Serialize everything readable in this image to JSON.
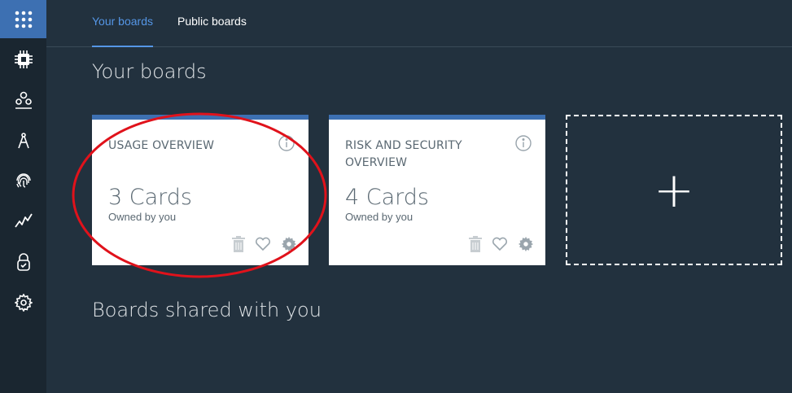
{
  "tabs": [
    {
      "label": "Your boards",
      "active": true
    },
    {
      "label": "Public boards",
      "active": false
    }
  ],
  "sections": {
    "your_boards": "Your boards",
    "shared_boards": "Boards shared with you"
  },
  "sidebar": {
    "icons": [
      "apps-grid-icon",
      "chip-icon",
      "users-icon",
      "compass-icon",
      "fingerprint-icon",
      "activity-icon",
      "lock-icon",
      "settings-icon"
    ],
    "active_index": 0
  },
  "boards": [
    {
      "title": "USAGE OVERVIEW",
      "count": "3 Cards",
      "owner": "Owned by you"
    },
    {
      "title": "RISK AND SECURITY OVERVIEW",
      "count": "4 Cards",
      "owner": "Owned by you"
    }
  ],
  "add_board": {
    "symbol": "+"
  },
  "colors": {
    "background": "#22313e",
    "sidebar": "#1a2630",
    "accent": "#3d70b2",
    "tab_active": "#5596e6",
    "annotation": "#e0121b"
  }
}
